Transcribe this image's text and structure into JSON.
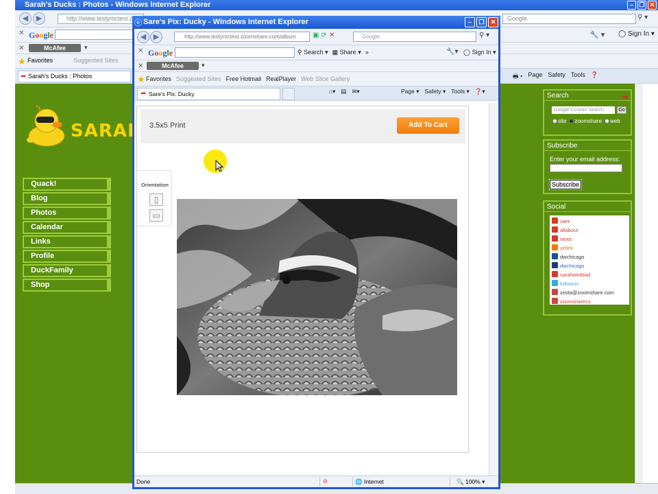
{
  "back_window": {
    "title": "Sarah's Ducks : Photos - Windows Internet Explorer",
    "address": "http://www.testymctest.zo",
    "search_placeholder": "Google",
    "google_toolbar": {
      "sign_in": "Sign In"
    },
    "mcafee": "McAfee",
    "favorites_label": "Favorites",
    "suggested_sites": "Suggested Sites",
    "tab_title": "Sarah's Ducks : Photos",
    "commands": [
      "Page",
      "Safety",
      "Tools"
    ]
  },
  "site": {
    "brand": "SARAH'",
    "nav": [
      "Quack!",
      "Blog",
      "Photos",
      "Calendar",
      "Links",
      "Profile",
      "DuckFamily",
      "Shop"
    ],
    "search_widget": {
      "title": "Search",
      "placeholder": "Google Custom Search",
      "go": "Go",
      "options": [
        "site",
        "zoomshare",
        "web"
      ]
    },
    "subscribe_widget": {
      "title": "Subscribe",
      "label": "Enter your email address:",
      "button": "Subscribe"
    },
    "social_widget": {
      "title": "Social",
      "links": [
        {
          "label": "sare",
          "color": "#d23c2a",
          "icon_color": "#d23c2a"
        },
        {
          "label": "allabout",
          "color": "#d23c2a",
          "icon_color": "#d23c2a"
        },
        {
          "label": "news",
          "color": "#d23c2a",
          "icon_color": "#d23c2a"
        },
        {
          "label": "yellek",
          "color": "#e07a10",
          "icon_color": "#f07d0d"
        },
        {
          "label": "dwchicago",
          "color": "#333333",
          "icon_color": "#1a4f99"
        },
        {
          "label": "dwchicago",
          "color": "#3366cc",
          "icon_color": "#223a7a"
        },
        {
          "label": "sarahwinblad",
          "color": "#d23c2a",
          "icon_color": "#d23c2a"
        },
        {
          "label": "followus",
          "color": "#33aadd",
          "icon_color": "#33aadd"
        },
        {
          "label": "zesta@zoomshare.com",
          "color": "#333333",
          "icon_color": "#c44"
        },
        {
          "label": "zoomsharecs",
          "color": "#d23c2a",
          "icon_color": "#c44"
        }
      ]
    }
  },
  "popup": {
    "title": "Sare's Pix: Ducky - Windows Internet Explorer",
    "address": "http://www.testymctest.zoomshare.com/album",
    "search_placeholder": "Google",
    "google_toolbar": {
      "search": "Search",
      "share": "Share",
      "sign_in": "Sign In"
    },
    "mcafee": "McAfee",
    "favorites": {
      "label": "Favorites",
      "links": [
        "Suggested Sites",
        "Free Hotmail",
        "RealPlayer",
        "Web Slice Gallery"
      ]
    },
    "tab_title": "Sare's Pix: Ducky",
    "commands": [
      "Page",
      "Safety",
      "Tools"
    ],
    "print_label": "3.5x5 Print",
    "add_to_cart": "Add To Cart",
    "orientation_label": "Orientation",
    "status": {
      "left": "Done",
      "zone": "Internet",
      "zoom": "100%"
    }
  }
}
